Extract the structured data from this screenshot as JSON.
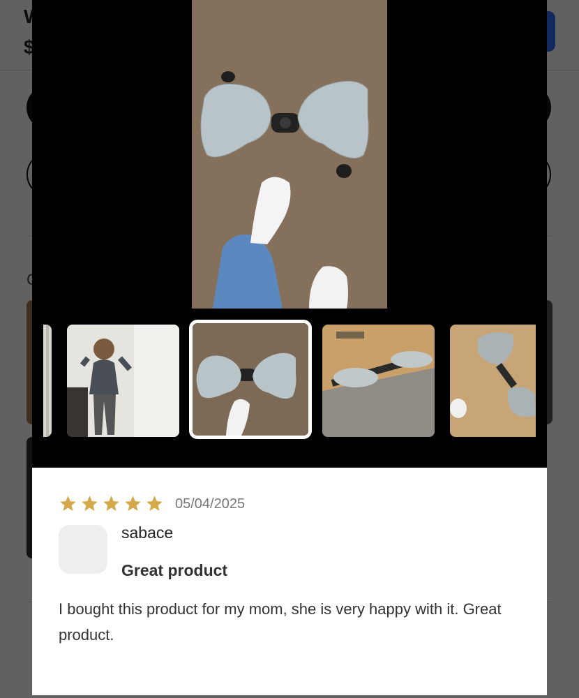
{
  "background_page": {
    "title_fragment": "W",
    "price_fragment": "$",
    "section_fragment": "C"
  },
  "media": {
    "main_photo_alt": "Foot stepper with two gray pedals on carpet",
    "thumbnails": [
      {
        "name": "partial-previous"
      },
      {
        "name": "woman-exercising"
      },
      {
        "name": "stepper-on-carpet",
        "active": true
      },
      {
        "name": "stepper-side-view"
      },
      {
        "name": "stepper-top-view"
      }
    ]
  },
  "review": {
    "rating": 5,
    "rating_max": 5,
    "date": "05/04/2025",
    "author": "sabace",
    "title": "Great product",
    "body": "I bought this product for my mom, she is very happy with it. Great product."
  },
  "colors": {
    "star": "#d4aa4a",
    "accent_button": "#2f6df6",
    "media_background": "#000000"
  }
}
